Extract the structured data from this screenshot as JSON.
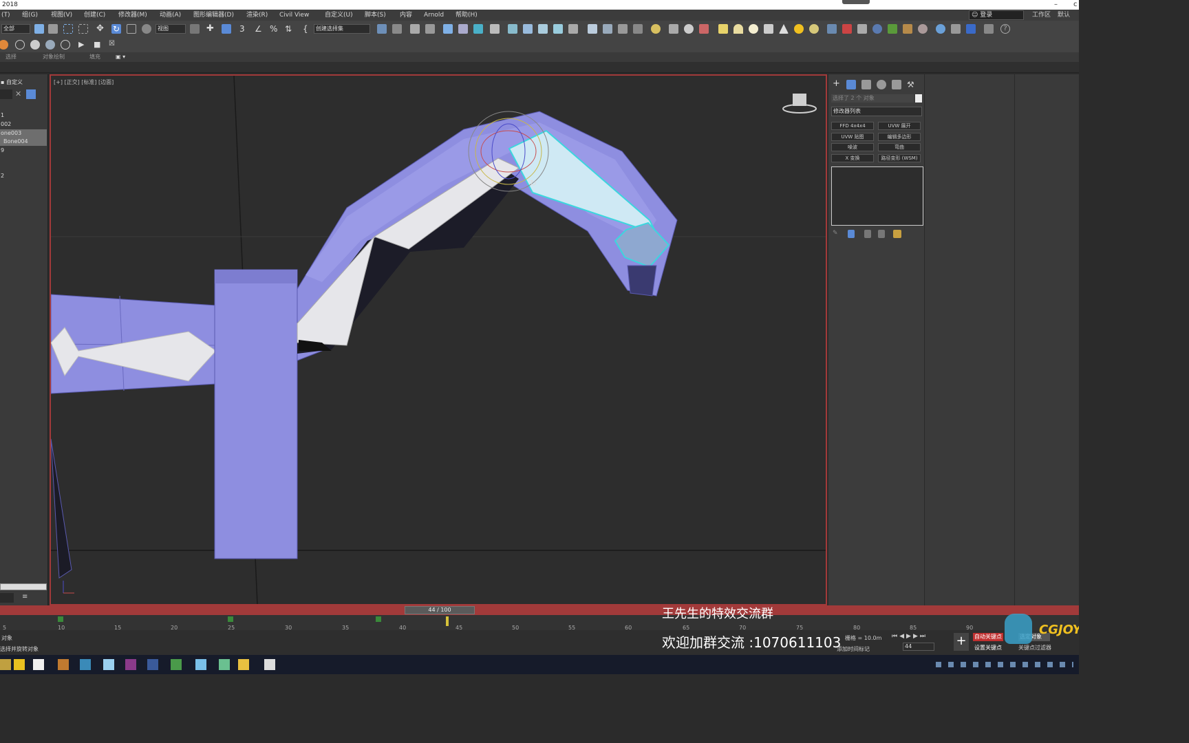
{
  "titlebar": {
    "title": "2018",
    "min": "–",
    "close": "c"
  },
  "menu": [
    "(T)",
    "组(G)",
    "视图(V)",
    "创建(C)",
    "修改器(M)",
    "动画(A)",
    "图形编辑器(D)",
    "渲染(R)",
    "Civil View",
    "自定义(U)",
    "脚本(S)",
    "内容",
    "Arnold",
    "帮助(H)"
  ],
  "account": {
    "login": "登录",
    "workspace": "工作区",
    "default": "默认"
  },
  "toolbar": {
    "filter": "全部",
    "ref_coord": "视图",
    "selection_set": "创建选择集"
  },
  "ribbon": {
    "tab1": "选择",
    "tab2": "对象绘制",
    "tab3": "填充"
  },
  "scene_explorer": {
    "tab": "自定义",
    "items": [
      "1",
      "002",
      "one003",
      "Bone004",
      "9",
      "",
      "",
      "2"
    ],
    "selected": [
      "one003",
      "Bone004"
    ]
  },
  "viewport": {
    "label": "[+] [正交] [标准] [边面]"
  },
  "command_panel": {
    "selection_info": "选择了 2 个 对象",
    "modifier_list": "修改器列表",
    "buttons": [
      "FFD 4x4x4",
      "UVW 展开",
      "UVW 贴图",
      "编辑多边形",
      "噪波",
      "弯曲",
      "X 变换",
      "路径变形 (WSM)"
    ]
  },
  "timeline": {
    "frame": "44 / 100",
    "ticks": [
      "5",
      "10",
      "15",
      "20",
      "25",
      "30",
      "35",
      "40",
      "45",
      "50",
      "55",
      "60",
      "65",
      "70",
      "75",
      "80",
      "85",
      "90"
    ],
    "current": 44
  },
  "status": {
    "line1": "对象",
    "line2": "选择并旋转对象",
    "grid": "栅格 = 10.0m",
    "add_time_tag": "添加时间标记",
    "frame_input": "44",
    "autokey": "自动关键点",
    "setkey": "设置关键点",
    "keyfilter": "关键点过滤器",
    "selected": "选定对象"
  },
  "overlay": {
    "line1": "王先生的特效交流群",
    "line2": "欢迎加群交流 :1070611103"
  },
  "watermark": "CGJOY",
  "colors": {
    "mesh": "#8e8ee0",
    "bone": "#e6e6ea",
    "selection": "#3cd6de",
    "viewport_border": "#a23a3a",
    "timeline": "#a23a3a"
  }
}
